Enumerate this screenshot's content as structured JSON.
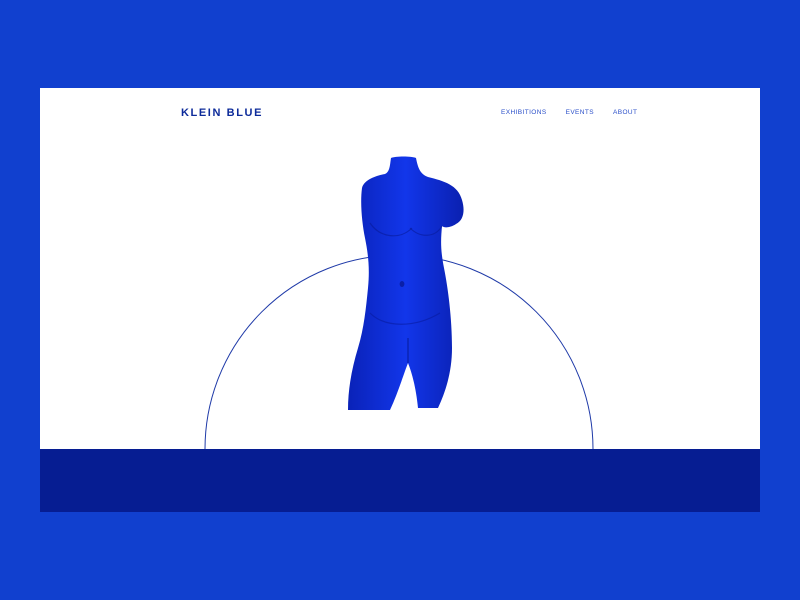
{
  "header": {
    "logo": "KLEIN BLUE"
  },
  "nav": {
    "items": [
      {
        "label": "EXHIBITIONS"
      },
      {
        "label": "EVENTS"
      },
      {
        "label": "ABOUT"
      }
    ]
  },
  "hero": {
    "image": "blue-venus-torso-sculpture",
    "decoration": "semicircle-outline"
  },
  "colors": {
    "background": "#1140cf",
    "page": "#ffffff",
    "floor": "#061d92",
    "accent": "#0d2b9a",
    "sculpture": "#0b2ee0"
  }
}
